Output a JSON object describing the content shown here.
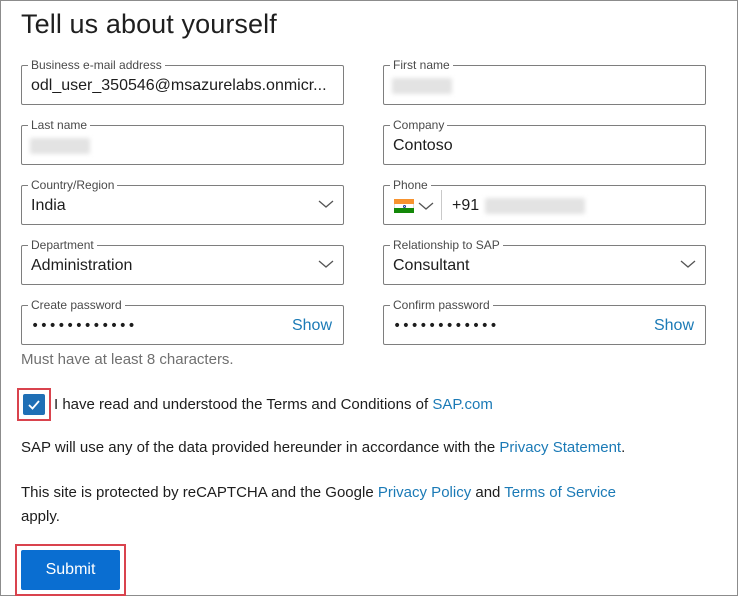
{
  "page": {
    "title": "Tell us about yourself"
  },
  "form": {
    "business_email": {
      "label": "Business e-mail address",
      "value": "odl_user_350546@msazurelabs.onmicr..."
    },
    "first_name": {
      "label": "First name",
      "value": ""
    },
    "last_name": {
      "label": "Last name",
      "value": ""
    },
    "company": {
      "label": "Company",
      "value": "Contoso"
    },
    "country": {
      "label": "Country/Region",
      "value": "India"
    },
    "phone": {
      "label": "Phone",
      "country_code": "+91",
      "value": "",
      "flag_colors": [
        "#f7932f",
        "#ffffff",
        "#138808"
      ]
    },
    "department": {
      "label": "Department",
      "value": "Administration"
    },
    "relationship": {
      "label": "Relationship to SAP",
      "value": "Consultant"
    },
    "create_password": {
      "label": "Create password",
      "value": "••••••••••••",
      "show_label": "Show"
    },
    "confirm_password": {
      "label": "Confirm password",
      "value": "••••••••••••",
      "show_label": "Show"
    },
    "password_hint": "Must have at least 8 characters."
  },
  "terms": {
    "checked": true,
    "text": "I have read and understood the Terms and Conditions of ",
    "link": "SAP.com"
  },
  "privacy": {
    "text": "SAP will use any of the data provided hereunder in accordance with the ",
    "link": "Privacy Statement",
    "end": "."
  },
  "recaptcha": {
    "text": "This site is protected by reCAPTCHA and the Google ",
    "privacy_link": "Privacy Policy",
    "and": " and ",
    "terms_link": "Terms of Service",
    "end": "apply."
  },
  "submit_label": "Submit",
  "colors": {
    "accent": "#0a6ed1",
    "link": "#1b7ab6",
    "highlight": "#d9434d"
  }
}
